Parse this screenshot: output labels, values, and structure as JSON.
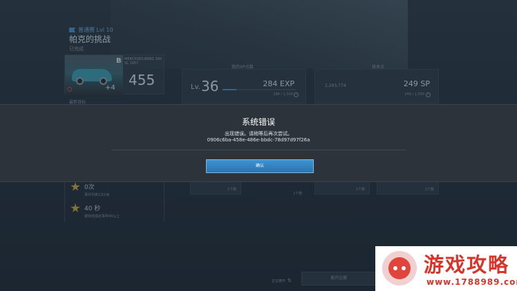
{
  "event": {
    "tag": "普通赛 Lvl 10",
    "title": "帕克的挑战",
    "subtitle": "已完成"
  },
  "car": {
    "class": "B",
    "plus": "+4",
    "info": "MERCEDES-BENZ 300 SL 1957",
    "pi": "455"
  },
  "section_label": "最新目标",
  "xp_panel": {
    "heading": "我的XP点数",
    "lv_label": "Lv.",
    "level": "36",
    "exp_value": "284",
    "exp_unit": "EXP",
    "exp_small": "284 / 1,500",
    "progress": 0.19
  },
  "sp_panel": {
    "heading": "技术点",
    "left_value": "2,293,774",
    "sp_value": "249",
    "sp_unit": "SP",
    "sp_small": "249 / 1,500"
  },
  "rewards": [
    {
      "main": "0次",
      "sub": "事件列表1次1级"
    },
    {
      "main": "40 秒",
      "sub": "最快完成此事件40以上"
    }
  ],
  "small_panels": [
    "1个数",
    "1个数",
    "1个数"
  ],
  "small_caption": "1个数",
  "bottom": {
    "switch_label": "正在离开",
    "switch_icon": "⇅",
    "button_label": "离开比赛"
  },
  "modal": {
    "title": "系统错误",
    "message": "出现错误。请稍等后再次尝试。",
    "code": "0906c6ba-458e-486e-bbdc-78d97d97f26a",
    "confirm_label": "确认"
  },
  "watermark": {
    "text": "游戏攻略",
    "url": "www.1788989.com"
  },
  "colors": {
    "accent": "#3f92d0",
    "star": "#d8b23a",
    "watermark": "#d8342a"
  }
}
